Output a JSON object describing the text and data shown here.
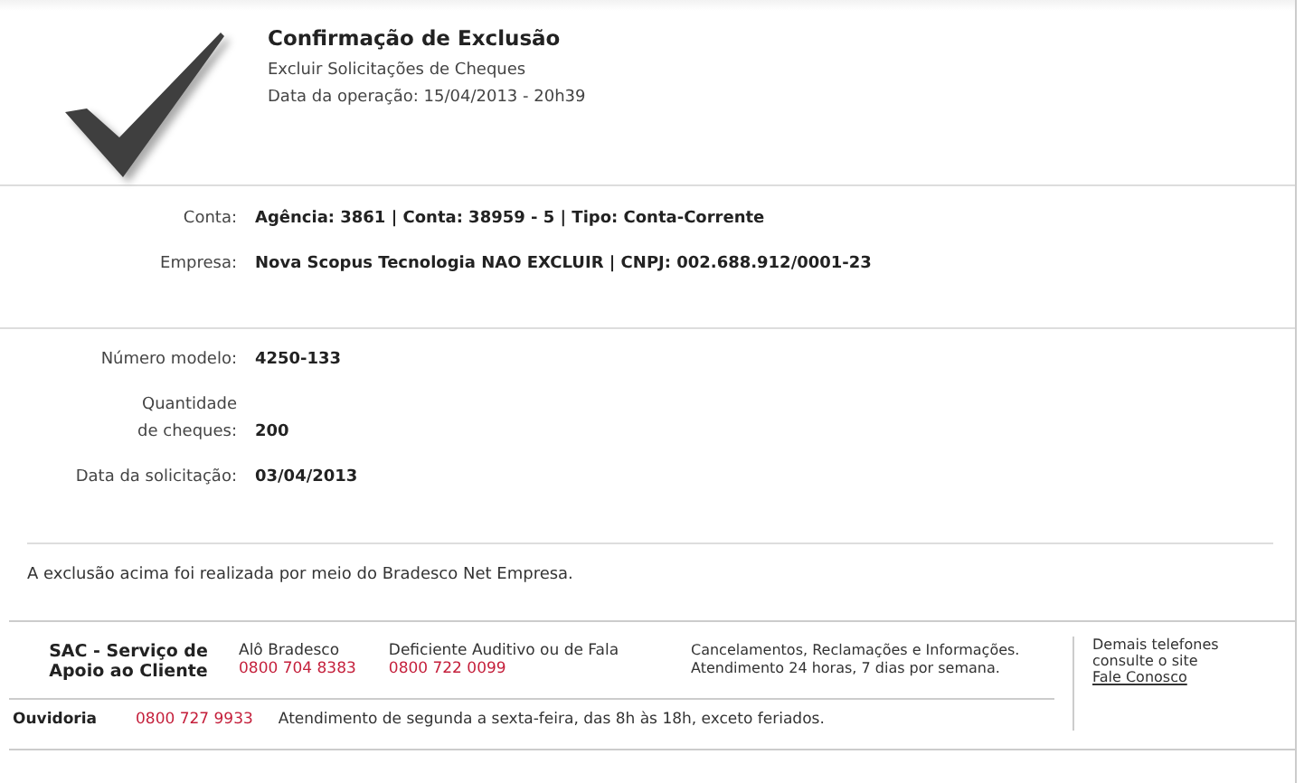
{
  "header": {
    "title": "Confirmação de Exclusão",
    "subtitle": "Excluir Solicitações de Cheques",
    "operation_date": "Data da operação: 15/04/2013 - 20h39"
  },
  "account_rows": [
    {
      "label": "Conta:",
      "value": "Agência: 3861 | Conta: 38959 - 5 | Tipo: Conta-Corrente"
    },
    {
      "label": "Empresa:",
      "value": "Nova Scopus Tecnologia NAO EXCLUIR | CNPJ: 002.688.912/0001-23"
    }
  ],
  "order_rows": [
    {
      "label": "Número modelo:",
      "value": "4250-133"
    },
    {
      "label": "Quantidade\nde cheques:",
      "value": "200"
    },
    {
      "label": "Data da solicitação:",
      "value": "03/04/2013"
    }
  ],
  "note": "A exclusão acima foi realizada por meio do Bradesco Net Empresa.",
  "footer": {
    "sac_title": "SAC - Serviço de\nApoio ao Cliente",
    "contacts": [
      {
        "name": "Alô Bradesco",
        "phone": "0800 704 8383"
      },
      {
        "name": "Deficiente Auditivo ou de Fala",
        "phone": "0800 722 0099"
      }
    ],
    "sac_info": "Cancelamentos, Reclamações e Informações.\nAtendimento 24 horas, 7 dias por semana.",
    "ouvidoria": {
      "label": "Ouvidoria",
      "phone": "0800 727 9933",
      "hours": "Atendimento de segunda a sexta-feira, das 8h às 18h, exceto feriados."
    },
    "other_phones": "Demais telefones\nconsulte o site",
    "link": "Fale Conosco"
  }
}
